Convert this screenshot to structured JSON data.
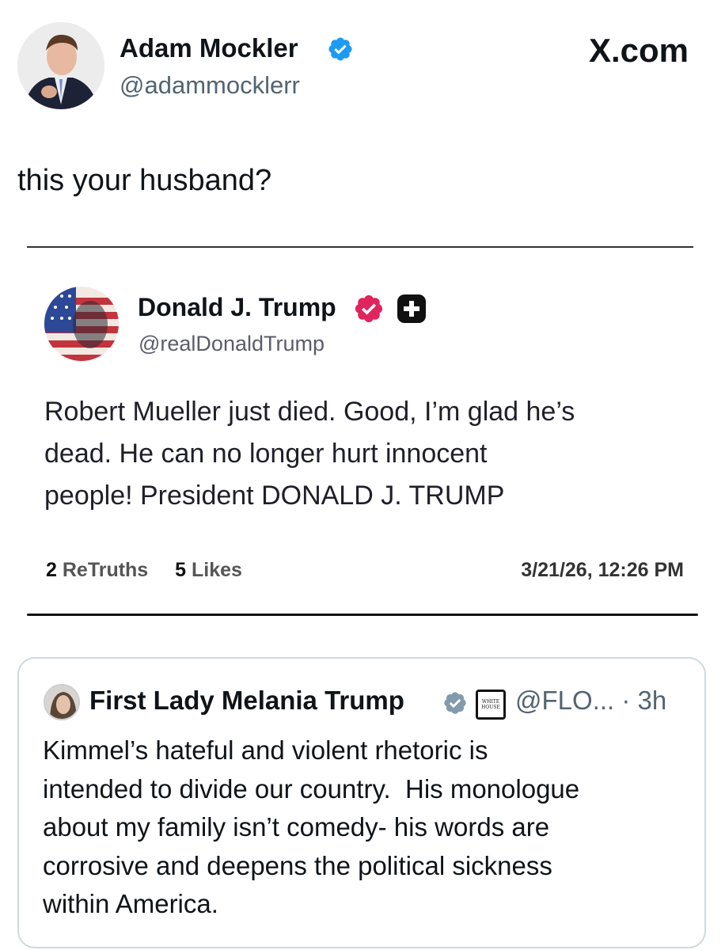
{
  "author": {
    "name": "Adam Mockler",
    "handle": "@adammocklerr",
    "verified_color": "#1d9bf0"
  },
  "site_label": "X.com",
  "tweet": {
    "text": "this your husband?"
  },
  "truth": {
    "name": "Donald J. Trump",
    "handle": "@realDonaldTrump",
    "verified_color": "#e0245e",
    "text_lines": [
      "Robert Mueller just died. Good, I’m glad he’s",
      "dead. He can no longer hurt innocent",
      "people! President DONALD J. TRUMP"
    ],
    "retruths_count": "2",
    "retruths_label": "ReTruths",
    "likes_count": "5",
    "likes_label": "Likes",
    "date": "3/21/26, 12:26 PM"
  },
  "quote": {
    "name": "First Lady Melania Trump",
    "handle": "@FLO...",
    "time": "3h",
    "badge_text": "WHITE HOUSE",
    "verified_color": "#829aab",
    "text_lines": [
      "Kimmel’s hateful and violent rhetoric is",
      "intended to divide our country.  His monologue",
      "about my family isn’t comedy- his words are",
      "corrosive and deepens the political sickness",
      "within America."
    ]
  }
}
